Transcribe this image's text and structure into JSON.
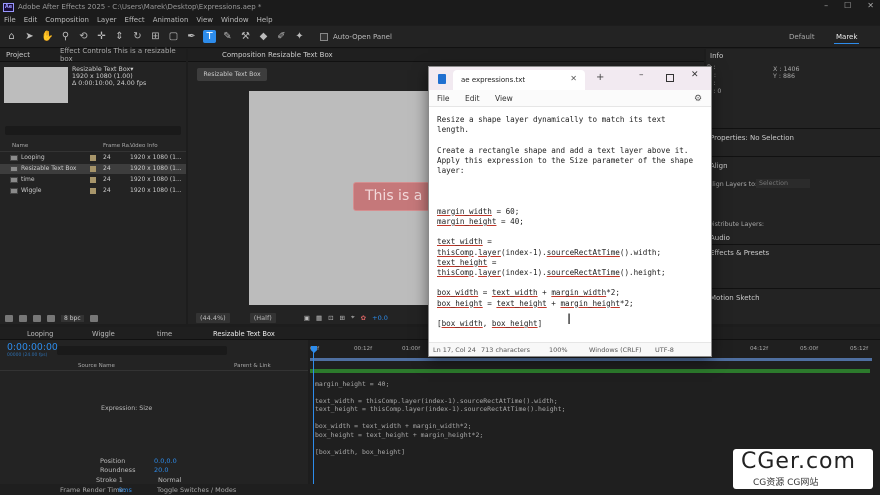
{
  "app": {
    "title": "Adobe After Effects 2025 - C:\\Users\\Marek\\Desktop\\Expressions.aep *",
    "logo": "Ae"
  },
  "menu": [
    "File",
    "Edit",
    "Composition",
    "Layer",
    "Effect",
    "Animation",
    "View",
    "Window",
    "Help"
  ],
  "toolbar": {
    "auto_open_label": "Auto-Open Panel",
    "workspace_default": "Default",
    "workspace_user": "Marek"
  },
  "project": {
    "tab_project": "Project",
    "tab_effect_controls": "Effect Controls This is a resizable box",
    "selected_name": "Resizable Text Box▾",
    "selected_size": "1920 x 1080 (1.00)",
    "selected_duration": "Δ 0:00:10:00, 24.00 fps",
    "col_name": "Name",
    "col_frame_rate": "Frame Ra...",
    "col_video_info": "Video Info",
    "items": [
      {
        "name": "Looping",
        "fps": "24",
        "info": "1920 x 1080 (1..."
      },
      {
        "name": "Resizable Text Box",
        "fps": "24",
        "info": "1920 x 1080 (1..."
      },
      {
        "name": "time",
        "fps": "24",
        "info": "1920 x 1080 (1..."
      },
      {
        "name": "Wiggle",
        "fps": "24",
        "info": "1920 x 1080 (1..."
      }
    ],
    "bpc": "8 bpc"
  },
  "comp": {
    "tab": "Composition Resizable Text Box",
    "button": "Resizable Text Box",
    "text_layer": "This is a",
    "zoom": "(44.4%)",
    "resolution": "(Half)",
    "exposure": "+0.0"
  },
  "info": {
    "title": "Info",
    "r": "R :",
    "g": "G :",
    "b": "B :",
    "a": "A : 0",
    "x": "X : 1406",
    "y": "Y : 886",
    "properties": "Properties: No Selection",
    "align": "Align",
    "align_layers_to": "Align Layers to:",
    "selection": "Selection",
    "distribute": "Distribute Layers:",
    "audio": "Audio",
    "effects_presets": "Effects & Presets",
    "motion_sketch": "Motion Sketch"
  },
  "timeline": {
    "tabs": [
      "Looping",
      "Wiggle",
      "time",
      "Resizable Text Box"
    ],
    "timecode": "0:00:00:00",
    "timecode_sub": "00000 (24.00 fps)",
    "ruler": [
      "00f",
      "00:12f",
      "01:00f",
      "04:12f",
      "05:00f",
      "05:12f"
    ],
    "col_source": "Source Name",
    "col_parent": "Parent & Link",
    "expression_label": "Expression: Size",
    "props": [
      {
        "name": "Position",
        "value": "0.0,0.0"
      },
      {
        "name": "Roundness",
        "value": "20.0"
      },
      {
        "name": "Stroke 1",
        "value": "Normal"
      }
    ],
    "code": [
      "margin_height = 40;",
      "",
      "text_width = thisComp.layer(index-1).sourceRectAtTime().width;",
      "text_height = thisComp.layer(index-1).sourceRectAtTime().height;",
      "",
      "box_width = text_width + margin_width*2;",
      "box_height = text_height + margin_height*2;",
      "",
      "[box_width, box_height]"
    ],
    "frame_render": "Frame Render Time:",
    "frame_render_val": "6ms",
    "toggle": "Toggle Switches / Modes"
  },
  "notepad": {
    "tab": "ae expressions.txt",
    "menu": [
      "File",
      "Edit",
      "View"
    ],
    "status": {
      "pos": "Ln 17, Col 24",
      "chars": "713 characters",
      "zoom": "100%",
      "eol": "Windows (CRLF)",
      "enc": "UTF-8"
    }
  },
  "watermark": {
    "big": "CGer.com",
    "small": "CG资源  CG网站"
  }
}
